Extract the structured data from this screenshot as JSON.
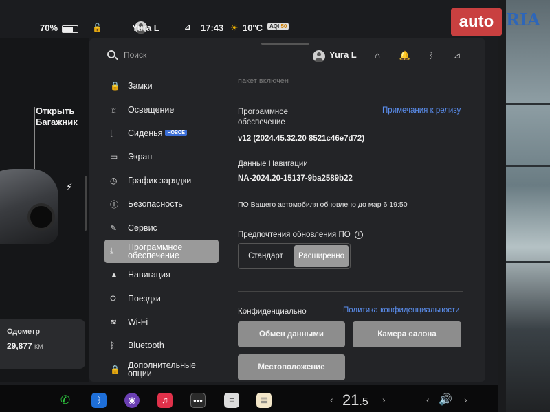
{
  "status": {
    "battery": "70%",
    "user": "Yura L",
    "time": "17:43",
    "temperature": "10°C",
    "aqi": "AQI",
    "aqi_value": "50"
  },
  "car": {
    "trunk_label": "Открыть Багажник",
    "odometer_label": "Одометр",
    "odometer_value": "29,877",
    "odometer_unit": "КМ"
  },
  "search": {
    "placeholder": "Поиск"
  },
  "top_user": "Yura L",
  "nav": [
    {
      "icon": "lock-icon",
      "glyph": "🔒",
      "label": "Замки"
    },
    {
      "icon": "light-icon",
      "glyph": "☼",
      "label": "Освещение"
    },
    {
      "icon": "seat-icon",
      "glyph": "⌊",
      "label": "Сиденья",
      "badge": "НОВОЕ"
    },
    {
      "icon": "display-icon",
      "glyph": "▭",
      "label": "Экран"
    },
    {
      "icon": "clock-icon",
      "glyph": "◷",
      "label": "График зарядки"
    },
    {
      "icon": "safety-icon",
      "glyph": "ⓘ",
      "label": "Безопасность"
    },
    {
      "icon": "wrench-icon",
      "glyph": "✎",
      "label": "Сервис"
    },
    {
      "icon": "download-icon",
      "glyph": "⤓",
      "label": "Программное обеспечение",
      "active": true
    },
    {
      "icon": "navigation-icon",
      "glyph": "▲",
      "label": "Навигация"
    },
    {
      "icon": "trips-icon",
      "glyph": "Ω",
      "label": "Поездки"
    },
    {
      "icon": "wifi-icon",
      "glyph": "≋",
      "label": "Wi-Fi"
    },
    {
      "icon": "bluetooth-icon",
      "glyph": "ᛒ",
      "label": "Bluetooth"
    },
    {
      "icon": "extra-lock-icon",
      "glyph": "🔒",
      "label": "Дополнительные опции"
    }
  ],
  "content": {
    "faded_top": "пакет включен",
    "software_label": "Программное обеспечение",
    "release_notes_link": "Примечания к релизу",
    "software_version": "v12 (2024.45.32.20 8521c46e7d72)",
    "nav_data_label": "Данные Навигации",
    "nav_data_version": "NA-2024.20-15137-9ba2589b22",
    "updated_text": "ПО Вашего автомобиля обновлено до мар 6 19:50",
    "update_pref_label": "Предпочтения обновления ПО",
    "pref_standard": "Стандарт",
    "pref_advanced": "Расширенно",
    "privacy_label": "Конфиденциально",
    "privacy_link": "Политика конфиденциальности",
    "data_sharing_btn": "Обмен данными",
    "cabin_camera_btn": "Камера салона",
    "location_btn": "Местоположение"
  },
  "dock": {
    "temp_int": "21",
    "temp_dec": ".5"
  },
  "watermark": {
    "auto": "auto",
    "ria": "RIA"
  }
}
